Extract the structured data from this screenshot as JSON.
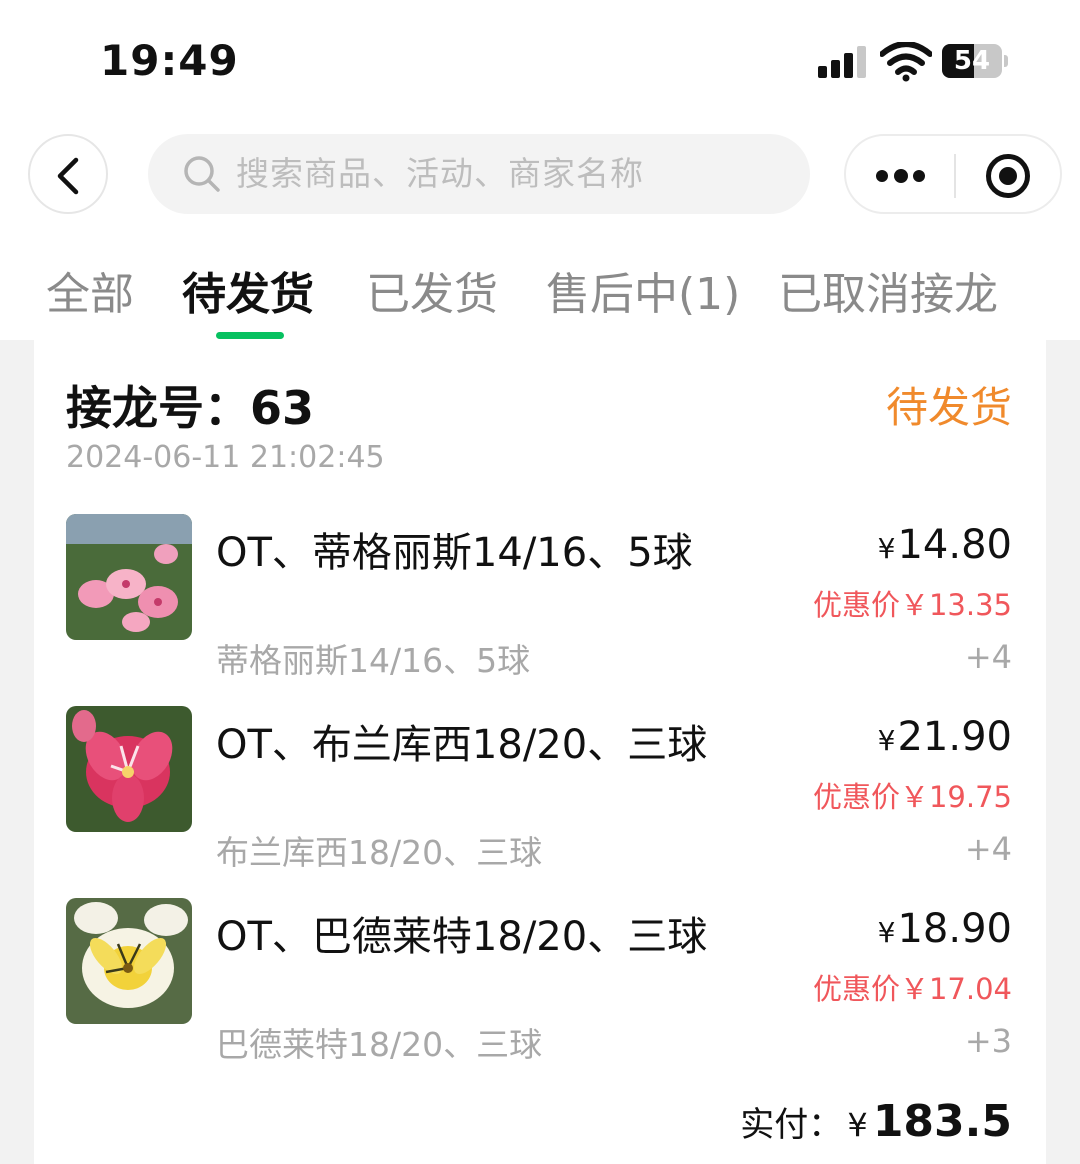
{
  "status_bar": {
    "time": "19:49",
    "battery": "54",
    "battery_level": 0.54,
    "icons": [
      "signal-icon",
      "wifi-icon",
      "battery-icon"
    ]
  },
  "nav": {
    "back_icon": "chevron-left-icon",
    "search_placeholder": "搜索商品、活动、商家名称",
    "more_icon": "more-dots-icon",
    "close_icon": "target-icon"
  },
  "tabs": [
    {
      "label": "全部",
      "active": false
    },
    {
      "label": "待发货",
      "active": true
    },
    {
      "label": "已发货",
      "active": false
    },
    {
      "label": "售后中(1)",
      "active": false
    },
    {
      "label": "已取消接龙",
      "active": false
    }
  ],
  "order": {
    "number_label": "接龙号：",
    "number": "63",
    "status": "待发货",
    "time": "2024-06-11 21:02:45",
    "items": [
      {
        "name": "OT、蒂格丽斯14/16、5球",
        "spec": "蒂格丽斯14/16、5球",
        "currency": "¥",
        "price": "14.80",
        "discount": "优惠价￥13.35",
        "qty": "+4"
      },
      {
        "name": "OT、布兰库西18/20、三球",
        "spec": "布兰库西18/20、三球",
        "currency": "¥",
        "price": "21.90",
        "discount": "优惠价￥19.75",
        "qty": "+4"
      },
      {
        "name": "OT、巴德莱特18/20、三球",
        "spec": "巴德莱特18/20、三球",
        "currency": "¥",
        "price": "18.90",
        "discount": "优惠价￥17.04",
        "qty": "+3"
      }
    ],
    "total_label": "实付：",
    "total_currency": "¥",
    "total_amount": "183.5"
  },
  "colors": {
    "accent_green": "#07c160",
    "status_orange": "#f08a2c",
    "discount_red": "#f0575b"
  }
}
